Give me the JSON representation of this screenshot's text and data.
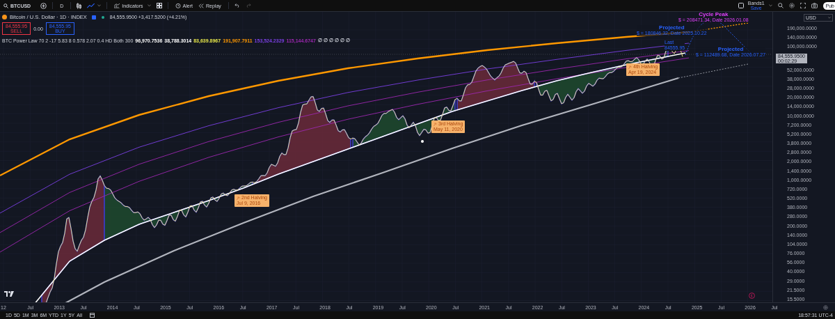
{
  "toolbar": {
    "symbol": "BTCUSD",
    "interval": "D",
    "indicators": "Indicators",
    "alert": "Alert",
    "replay": "Replay",
    "layout_name": "Bands1",
    "layout_status": "Save",
    "publish": "Pub"
  },
  "legend": {
    "title": "Bitcoin / U.S. Dollar · 1D · INDEX",
    "quote": "84,555.9500 +3,417.5200 (+4.21%)",
    "sell": {
      "price": "84,555.95",
      "label": "SELL"
    },
    "spread": "0.00",
    "buy": {
      "price": "84,555.95",
      "label": "BUY"
    },
    "indicator": {
      "name": "BTC Power Law 70 2 -17 5.83 8 0.578 2.07 0.4 HD Both 300",
      "values": [
        {
          "text": "96,970.7536",
          "color": "#ffffff"
        },
        {
          "text": "38,788.3014",
          "color": "#ffffff"
        },
        {
          "text": "83,639.8967",
          "color": "#e8e84a"
        },
        {
          "text": "191,907.7911",
          "color": "#ff9800"
        },
        {
          "text": "153,524.2329",
          "color": "#7b3fe4"
        },
        {
          "text": "115,144.6747",
          "color": "#9c27b0"
        }
      ],
      "flags": "∅ ∅ ∅ ∅ ∅ ∅"
    }
  },
  "halvings": [
    {
      "title": "2nd Halving",
      "date": "Jul 9, 2016"
    },
    {
      "title": "3rd Halving",
      "date": "May 11, 2020"
    },
    {
      "title": "4th Halving",
      "date": "Apr 19, 2024"
    }
  ],
  "projections": [
    {
      "title": "Cycle Peak",
      "detail": "$ = 208471.34, Date 2026.01.08",
      "color": "#e040fb"
    },
    {
      "title": "Projected",
      "detail": "$ = 180846.32, Date 2025.10.22",
      "color": "#2962ff"
    },
    {
      "title": "Projected",
      "detail": "$ = 112489.68, Date 2026.07.27",
      "color": "#2962ff"
    }
  ],
  "last": {
    "title": "Last",
    "value": "84555.95"
  },
  "price_axis": {
    "currency": "USD",
    "labels_above": [
      "190,000.0000",
      "140,000.0000",
      "100,000.0000"
    ],
    "current": {
      "price": "84,555.9500",
      "countdown": "00:02:29"
    },
    "labels_below": [
      "52,000.0000",
      "38,000.0000",
      "28,000.0000",
      "20,000.0000",
      "14,000.0000",
      "10,000.0000",
      "7,200.0000",
      "5,200.0000",
      "3,800.0000",
      "2,800.0000",
      "2,000.0000",
      "1,400.0000",
      "1,000.0000",
      "720.0000",
      "520.0000",
      "380.0000",
      "280.0000",
      "200.0000",
      "140.0000",
      "104.0000",
      "76.0000",
      "56.0000",
      "40.0000",
      "29.0000",
      "21.5000",
      "15.5000"
    ]
  },
  "time_axis": {
    "labels": [
      "12",
      "Jul",
      "2013",
      "Jul",
      "2014",
      "Jul",
      "2015",
      "Jul",
      "2016",
      "Jul",
      "2017",
      "Jul",
      "2018",
      "Jul",
      "2019",
      "Jul",
      "2020",
      "Jul",
      "2021",
      "Jul",
      "2022",
      "Jul",
      "2023",
      "Jul",
      "2024",
      "Jul",
      "2025",
      "Jul",
      "2026",
      "Jul"
    ]
  },
  "bottom_bar": {
    "ranges": [
      "1D",
      "5D",
      "1M",
      "3M",
      "6M",
      "YTD",
      "1Y",
      "5Y",
      "All"
    ],
    "clock": "18:57:31 UTC-4"
  }
}
